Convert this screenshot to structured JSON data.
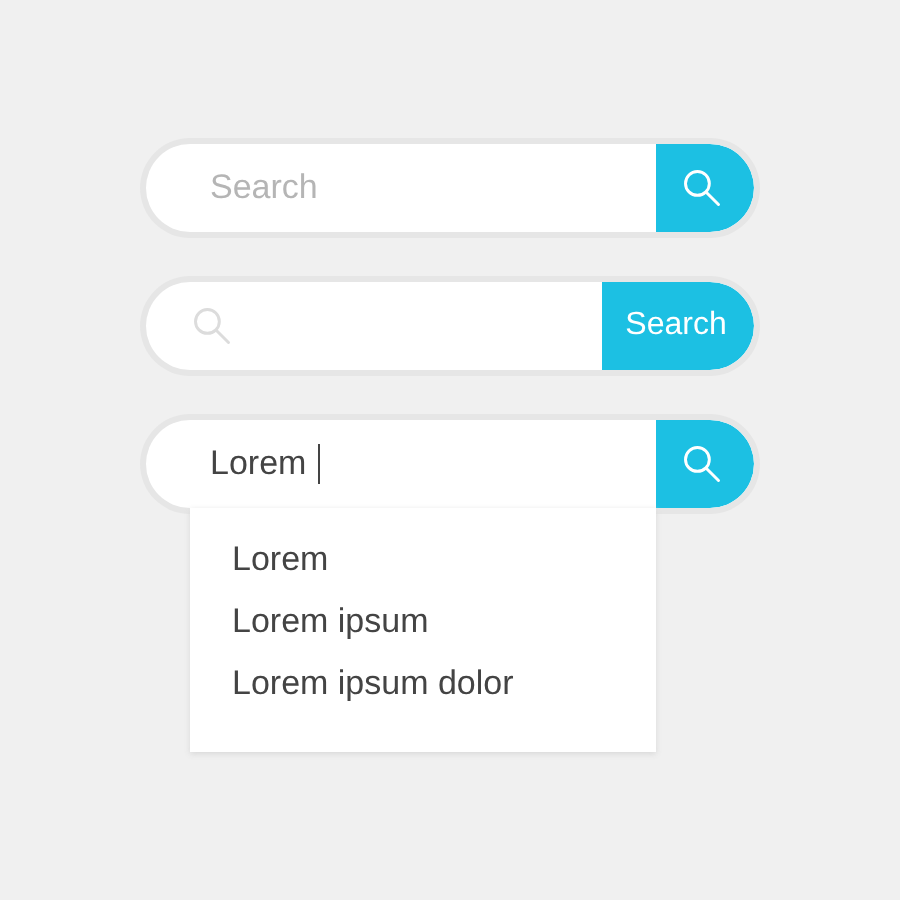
{
  "search_bars": [
    {
      "kind": "icon_button",
      "placeholder": "Search"
    },
    {
      "kind": "text_button",
      "button_label": "Search"
    },
    {
      "kind": "icon_button",
      "value": "Lorem",
      "suggestions": [
        "Lorem",
        "Lorem ipsum",
        "Lorem ipsum dolor"
      ]
    }
  ]
}
